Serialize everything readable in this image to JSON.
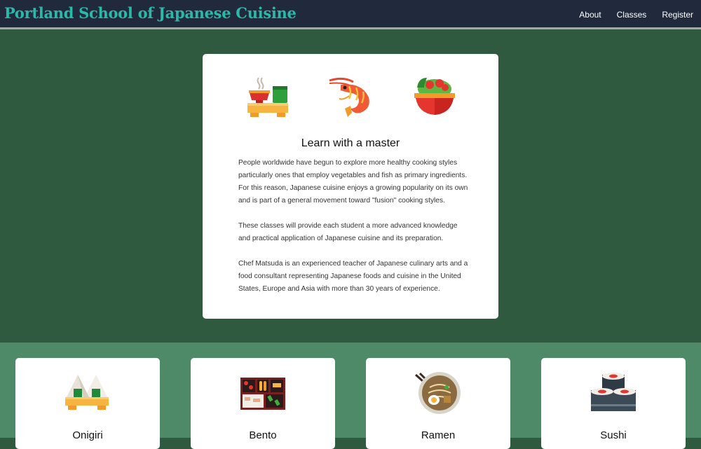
{
  "header": {
    "brand": "Portland School of Japanese Cuisine",
    "nav": [
      {
        "label": "About"
      },
      {
        "label": "Classes"
      },
      {
        "label": "Register"
      }
    ]
  },
  "hero": {
    "icons": [
      "tea-set-icon",
      "shrimp-icon",
      "salad-bowl-icon"
    ],
    "title": "Learn with a master",
    "paragraphs": [
      "People worldwide have begun to explore more healthy cooking styles particularly ones that employ vegetables and fish as primary ingredients. For this reason, Japanese cuisine enjoys a growing popularity on its own and is part of a general movement toward \"fusion\" cooking styles.",
      "These classes will provide each student a more advanced knowledge and practical application of Japanese cuisine and its preparation.",
      "Chef Matsuda is an experienced teacher of Japanese culinary arts and a food consultant representing Japanese foods and cuisine in the United States, Europe and Asia with more than 30 years of experience."
    ]
  },
  "classes": [
    {
      "name": "Onigiri",
      "icon": "onigiri-icon"
    },
    {
      "name": "Bento",
      "icon": "bento-box-icon"
    },
    {
      "name": "Ramen",
      "icon": "ramen-bowl-icon"
    },
    {
      "name": "Sushi",
      "icon": "sushi-rolls-icon"
    }
  ],
  "colors": {
    "navbar": "#212a3d",
    "brand": "#2ab8a8",
    "hero_bg": "#2f5a40",
    "classes_bg": "#4e8a68",
    "card": "#ffffff"
  }
}
